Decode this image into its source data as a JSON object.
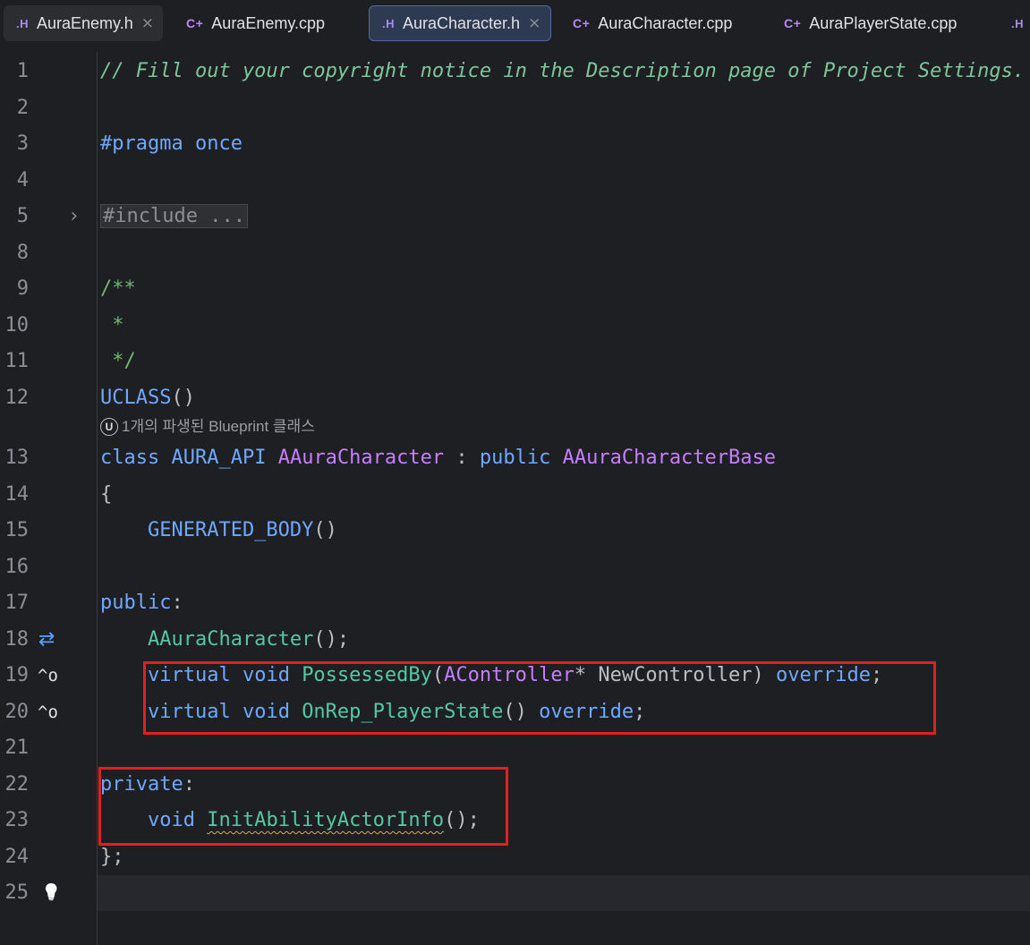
{
  "tabs": [
    {
      "icon": ".H",
      "label": "AuraEnemy.h",
      "close": "×"
    },
    {
      "icon": "C+",
      "label": "AuraEnemy.cpp"
    },
    {
      "icon": ".H",
      "label": "AuraCharacter.h",
      "close": "×"
    },
    {
      "icon": "C+",
      "label": "AuraCharacter.cpp"
    },
    {
      "icon": "C+",
      "label": "AuraPlayerState.cpp"
    },
    {
      "icon": ".H",
      "label": ""
    }
  ],
  "gutter_icons": {
    "fold_expand": "›",
    "implements": "⇄",
    "override_19": "^o",
    "override_20": "^o",
    "hint_bulb": "💡"
  },
  "inlay_hint": {
    "badge": "U",
    "text": "1개의 파생된 Blueprint 클래스"
  },
  "lines": [
    {
      "num": "1",
      "tokens": [
        {
          "t": "// Fill out your copyright notice in the Description page of Project Settings.",
          "c": "cm"
        }
      ]
    },
    {
      "num": "2",
      "tokens": []
    },
    {
      "num": "3",
      "tokens": [
        {
          "t": "#pragma once",
          "c": "kw"
        }
      ]
    },
    {
      "num": "4",
      "tokens": []
    },
    {
      "num": "5",
      "tokens": [
        {
          "t": "#include ...",
          "c": "fold"
        }
      ]
    },
    {
      "num": "8",
      "tokens": []
    },
    {
      "num": "9",
      "tokens": [
        {
          "t": "/**",
          "c": "cm-doc"
        }
      ]
    },
    {
      "num": "10",
      "tokens": [
        {
          "t": " *",
          "c": "cm-doc"
        }
      ]
    },
    {
      "num": "11",
      "tokens": [
        {
          "t": " */",
          "c": "cm-doc"
        }
      ]
    },
    {
      "num": "12",
      "tokens": [
        {
          "t": "UCLASS",
          "c": "mac"
        },
        {
          "t": "()",
          "c": "pl"
        }
      ]
    },
    {
      "num": "13",
      "tokens": [
        {
          "t": "class ",
          "c": "kw"
        },
        {
          "t": "AURA_API ",
          "c": "mac"
        },
        {
          "t": "AAuraCharacter",
          "c": "cls"
        },
        {
          "t": " : ",
          "c": "pl"
        },
        {
          "t": "public ",
          "c": "kw"
        },
        {
          "t": "AAuraCharacterBase",
          "c": "cls"
        }
      ]
    },
    {
      "num": "14",
      "tokens": [
        {
          "t": "{",
          "c": "pl"
        }
      ]
    },
    {
      "num": "15",
      "tokens": [
        {
          "t": "    GENERATED_BODY",
          "c": "mac"
        },
        {
          "t": "()",
          "c": "pl"
        }
      ]
    },
    {
      "num": "16",
      "tokens": []
    },
    {
      "num": "17",
      "tokens": [
        {
          "t": "public",
          "c": "kw"
        },
        {
          "t": ":",
          "c": "pl"
        }
      ]
    },
    {
      "num": "18",
      "tokens": [
        {
          "t": "    AAuraCharacter",
          "c": "fn"
        },
        {
          "t": "();",
          "c": "pl"
        }
      ]
    },
    {
      "num": "19",
      "tokens": [
        {
          "t": "    virtual ",
          "c": "kw"
        },
        {
          "t": "void ",
          "c": "kw"
        },
        {
          "t": "PossessedBy",
          "c": "fn"
        },
        {
          "t": "(",
          "c": "pl"
        },
        {
          "t": "AController",
          "c": "cls"
        },
        {
          "t": "* NewController) ",
          "c": "pl"
        },
        {
          "t": "override",
          "c": "kw"
        },
        {
          "t": ";",
          "c": "pl"
        }
      ]
    },
    {
      "num": "20",
      "tokens": [
        {
          "t": "    virtual ",
          "c": "kw"
        },
        {
          "t": "void ",
          "c": "kw"
        },
        {
          "t": "OnRep_PlayerState",
          "c": "fn"
        },
        {
          "t": "() ",
          "c": "pl"
        },
        {
          "t": "override",
          "c": "kw"
        },
        {
          "t": ";",
          "c": "pl"
        }
      ]
    },
    {
      "num": "21",
      "tokens": []
    },
    {
      "num": "22",
      "tokens": [
        {
          "t": "private",
          "c": "kw"
        },
        {
          "t": ":",
          "c": "pl"
        }
      ]
    },
    {
      "num": "23",
      "tokens": [
        {
          "t": "    void ",
          "c": "kw"
        },
        {
          "t": "InitAbilityActorInfo",
          "c": "fn squig"
        },
        {
          "t": "();",
          "c": "pl"
        }
      ]
    },
    {
      "num": "24",
      "tokens": [
        {
          "t": "};",
          "c": "pl"
        }
      ]
    },
    {
      "num": "25",
      "tokens": []
    }
  ],
  "colors": {
    "background": "#1e1f22",
    "keyword": "#6fa8ff",
    "class": "#c77dff",
    "function": "#56c8a0",
    "comment": "#7ec699",
    "highlight_box": "#e02020"
  }
}
